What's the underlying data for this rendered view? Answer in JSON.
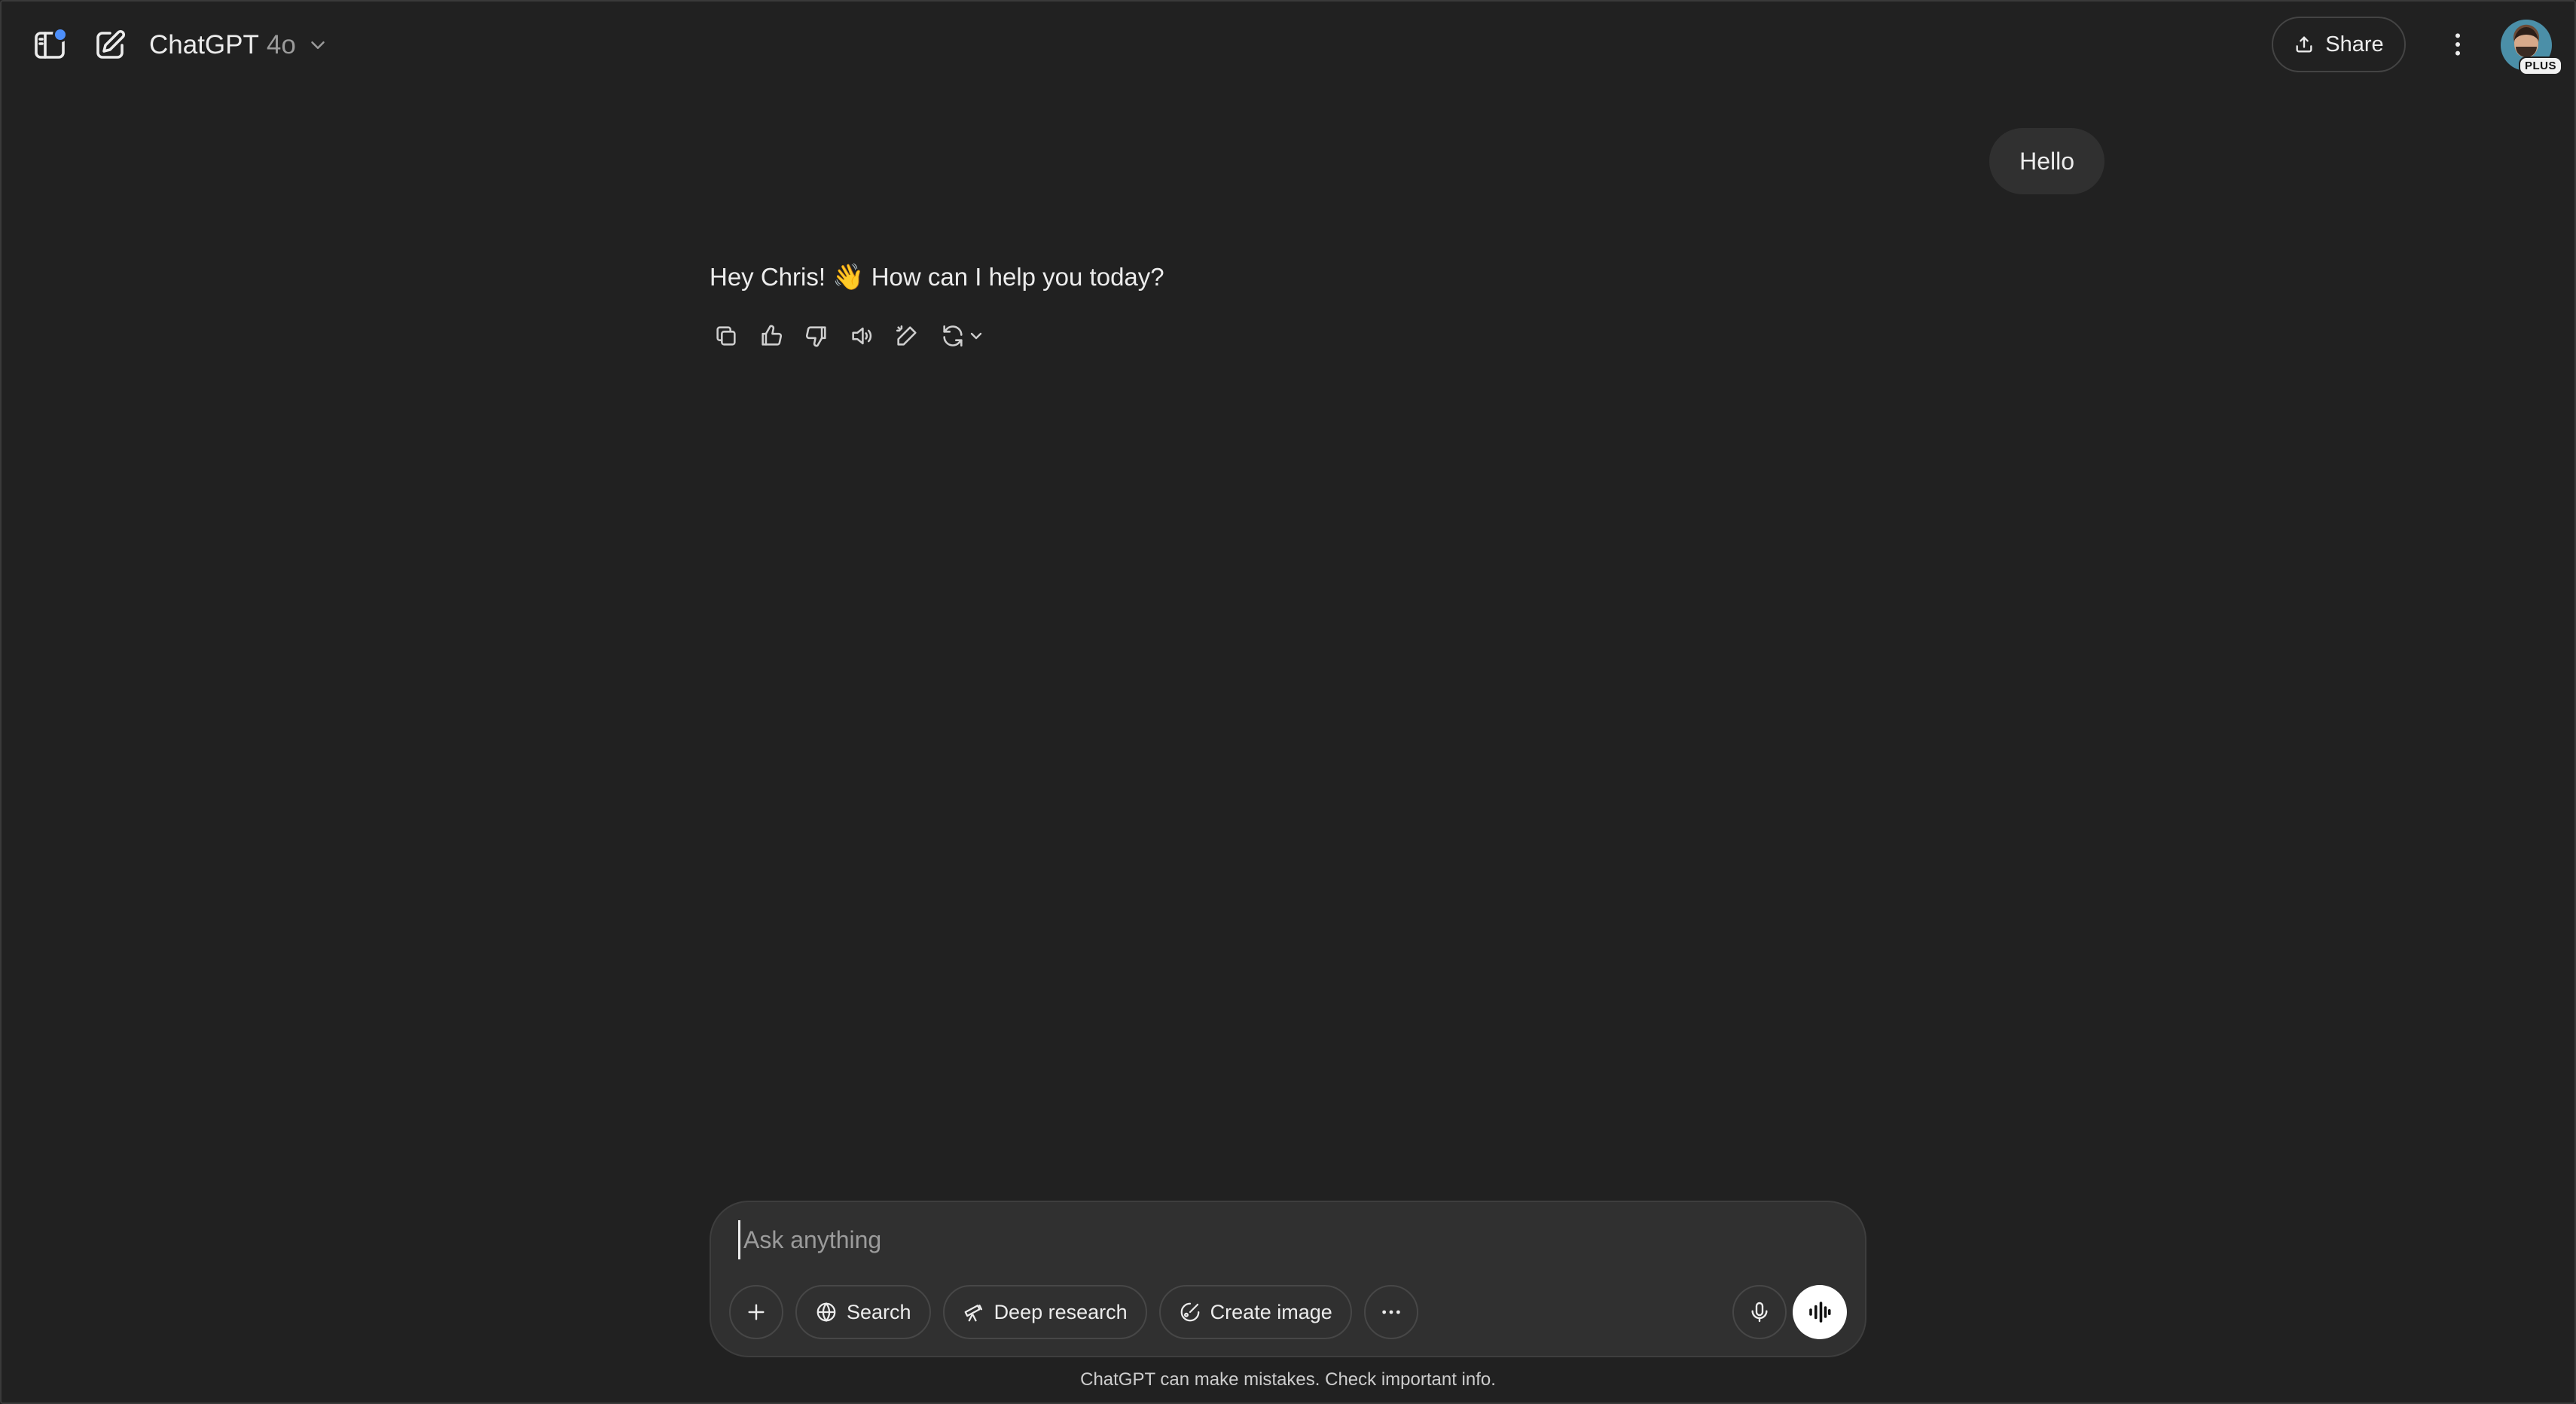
{
  "header": {
    "model_name": "ChatGPT",
    "model_version": "4o",
    "share_label": "Share",
    "avatar_badge": "PLUS"
  },
  "conversation": {
    "user_message": "Hello",
    "assistant_text": "Hey Chris!",
    "assistant_emoji": "👋",
    "assistant_text_after": "How can I help you today?"
  },
  "composer": {
    "placeholder": "Ask anything",
    "value": "",
    "tools": {
      "search_label": "Search",
      "deep_research_label": "Deep research",
      "create_image_label": "Create image"
    }
  },
  "footer": {
    "disclaimer": "ChatGPT can make mistakes. Check important info."
  },
  "icons": {
    "sidebar": "sidebar-icon",
    "new_chat": "new-chat-icon",
    "chevron": "chevron-down-icon",
    "share": "share-icon",
    "more": "more-vertical-icon",
    "copy": "copy-icon",
    "like": "thumbs-up-icon",
    "dislike": "thumbs-down-icon",
    "read_aloud": "speaker-icon",
    "edit": "edit-in-canvas-icon",
    "regenerate": "regenerate-icon",
    "plus": "plus-icon",
    "globe": "globe-icon",
    "telescope": "telescope-icon",
    "image": "image-brush-icon",
    "ellipsis": "more-horizontal-icon",
    "mic": "mic-icon",
    "voice": "voice-mode-icon"
  },
  "colors": {
    "background": "#212121",
    "surface": "#303030",
    "text": "#ececec",
    "muted": "#9b9b9b",
    "notification_dot": "#4d8ffa"
  }
}
